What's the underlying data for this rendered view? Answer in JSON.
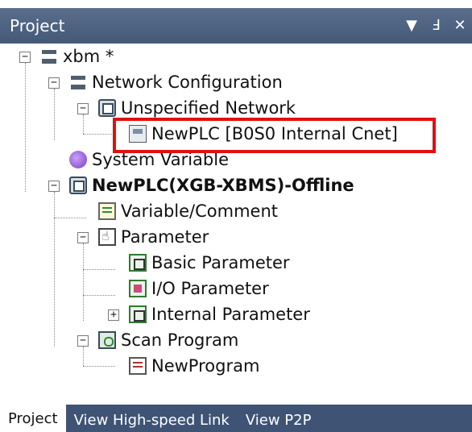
{
  "panel": {
    "title": "Project"
  },
  "title_buttons": {
    "dropdown": "▼",
    "pin": "Ⅎ",
    "close": "✕"
  },
  "tree": {
    "root": {
      "label": "xbm *",
      "toggle": "−"
    },
    "network_configuration": {
      "label": "Network Configuration",
      "toggle": "−"
    },
    "unspecified_network": {
      "label": "Unspecified Network",
      "toggle": "−"
    },
    "newplc_cnet": {
      "label": "NewPLC [B0S0 Internal Cnet]"
    },
    "system_variable": {
      "label": "System Variable"
    },
    "newplc_offline": {
      "label": "NewPLC(XGB-XBMS)-Offline",
      "toggle": "−"
    },
    "variable_comment": {
      "label": "Variable/Comment"
    },
    "parameter": {
      "label": "Parameter",
      "toggle": "−"
    },
    "basic_parameter": {
      "label": "Basic Parameter"
    },
    "io_parameter": {
      "label": "I/O Parameter"
    },
    "internal_parameter": {
      "label": "Internal Parameter",
      "toggle": "+"
    },
    "scan_program": {
      "label": "Scan Program",
      "toggle": "−"
    },
    "new_program": {
      "label": "NewProgram"
    }
  },
  "tabs": [
    {
      "label": "Project"
    },
    {
      "label": "View High-speed Link"
    },
    {
      "label": "View P2P"
    }
  ],
  "colors": {
    "titlebar": "#4d6280",
    "highlight": "#e01010",
    "tabbar": "#3f5474"
  }
}
